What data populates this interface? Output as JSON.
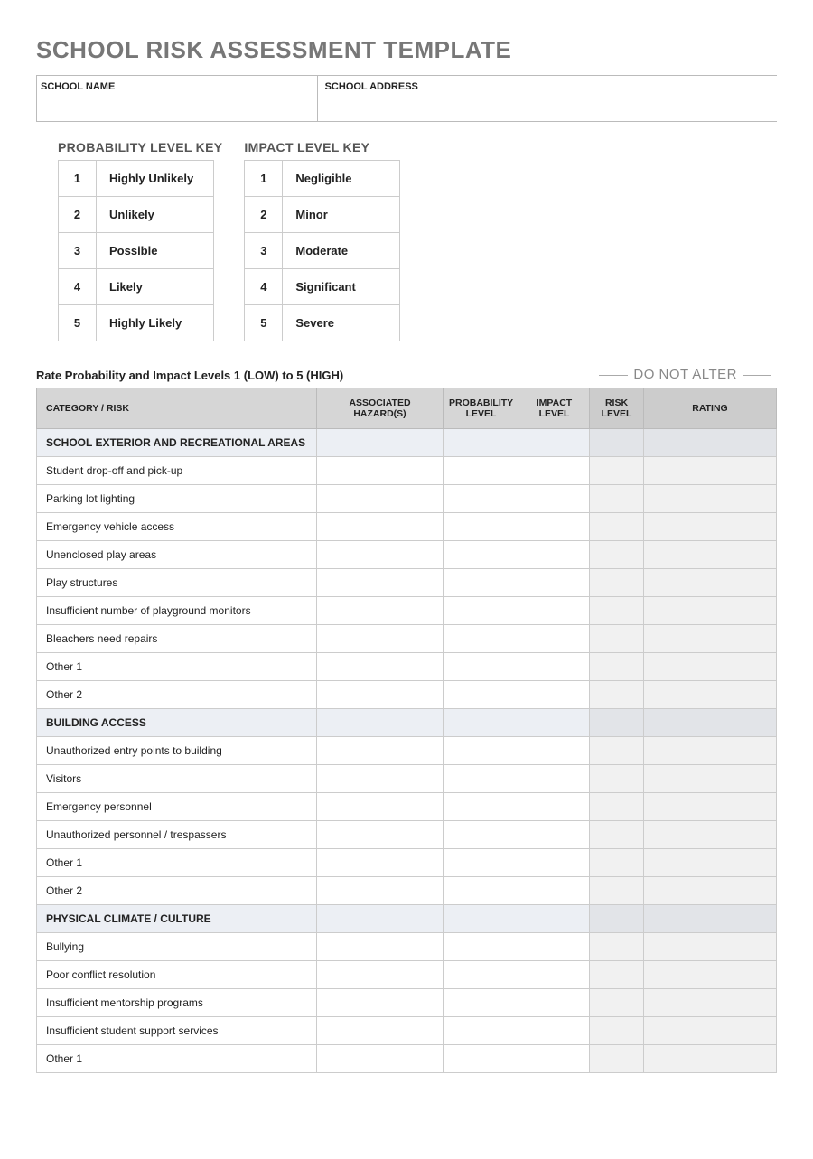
{
  "title": "SCHOOL RISK ASSESSMENT TEMPLATE",
  "school_name_label": "SCHOOL NAME",
  "school_address_label": "SCHOOL ADDRESS",
  "probability_key": {
    "title": "PROBABILITY LEVEL KEY",
    "rows": [
      {
        "n": "1",
        "l": "Highly Unlikely"
      },
      {
        "n": "2",
        "l": "Unlikely"
      },
      {
        "n": "3",
        "l": "Possible"
      },
      {
        "n": "4",
        "l": "Likely"
      },
      {
        "n": "5",
        "l": "Highly Likely"
      }
    ]
  },
  "impact_key": {
    "title": "IMPACT LEVEL KEY",
    "rows": [
      {
        "n": "1",
        "l": "Negligible"
      },
      {
        "n": "2",
        "l": "Minor"
      },
      {
        "n": "3",
        "l": "Moderate"
      },
      {
        "n": "4",
        "l": "Significant"
      },
      {
        "n": "5",
        "l": "Severe"
      }
    ]
  },
  "rate_label": "Rate Probability and Impact Levels 1 (LOW) to 5 (HIGH)",
  "do_not_alter": "DO NOT ALTER",
  "main_headers": {
    "cat": "CATEGORY / RISK",
    "haz": "ASSOCIATED HAZARD(S)",
    "prob": "PROBABILITY LEVEL",
    "imp": "IMPACT LEVEL",
    "risk": "RISK LEVEL",
    "rating": "RATING"
  },
  "rows": [
    {
      "type": "section",
      "label": "SCHOOL EXTERIOR AND RECREATIONAL AREAS"
    },
    {
      "type": "item",
      "label": "Student drop-off and pick-up"
    },
    {
      "type": "item",
      "label": "Parking lot lighting"
    },
    {
      "type": "item",
      "label": "Emergency vehicle access"
    },
    {
      "type": "item",
      "label": "Unenclosed play areas"
    },
    {
      "type": "item",
      "label": "Play structures"
    },
    {
      "type": "item",
      "label": "Insufficient number of playground monitors"
    },
    {
      "type": "item",
      "label": "Bleachers need repairs"
    },
    {
      "type": "item",
      "label": "Other 1"
    },
    {
      "type": "item",
      "label": "Other 2"
    },
    {
      "type": "section",
      "label": "BUILDING ACCESS"
    },
    {
      "type": "item",
      "label": "Unauthorized entry points to building"
    },
    {
      "type": "item",
      "label": "Visitors"
    },
    {
      "type": "item",
      "label": "Emergency personnel"
    },
    {
      "type": "item",
      "label": "Unauthorized personnel / trespassers"
    },
    {
      "type": "item",
      "label": "Other 1"
    },
    {
      "type": "item",
      "label": "Other 2"
    },
    {
      "type": "section",
      "label": "PHYSICAL CLIMATE / CULTURE"
    },
    {
      "type": "item",
      "label": "Bullying"
    },
    {
      "type": "item",
      "label": "Poor conflict resolution"
    },
    {
      "type": "item",
      "label": "Insufficient mentorship programs"
    },
    {
      "type": "item",
      "label": "Insufficient student support services"
    },
    {
      "type": "item",
      "label": "Other 1"
    }
  ]
}
